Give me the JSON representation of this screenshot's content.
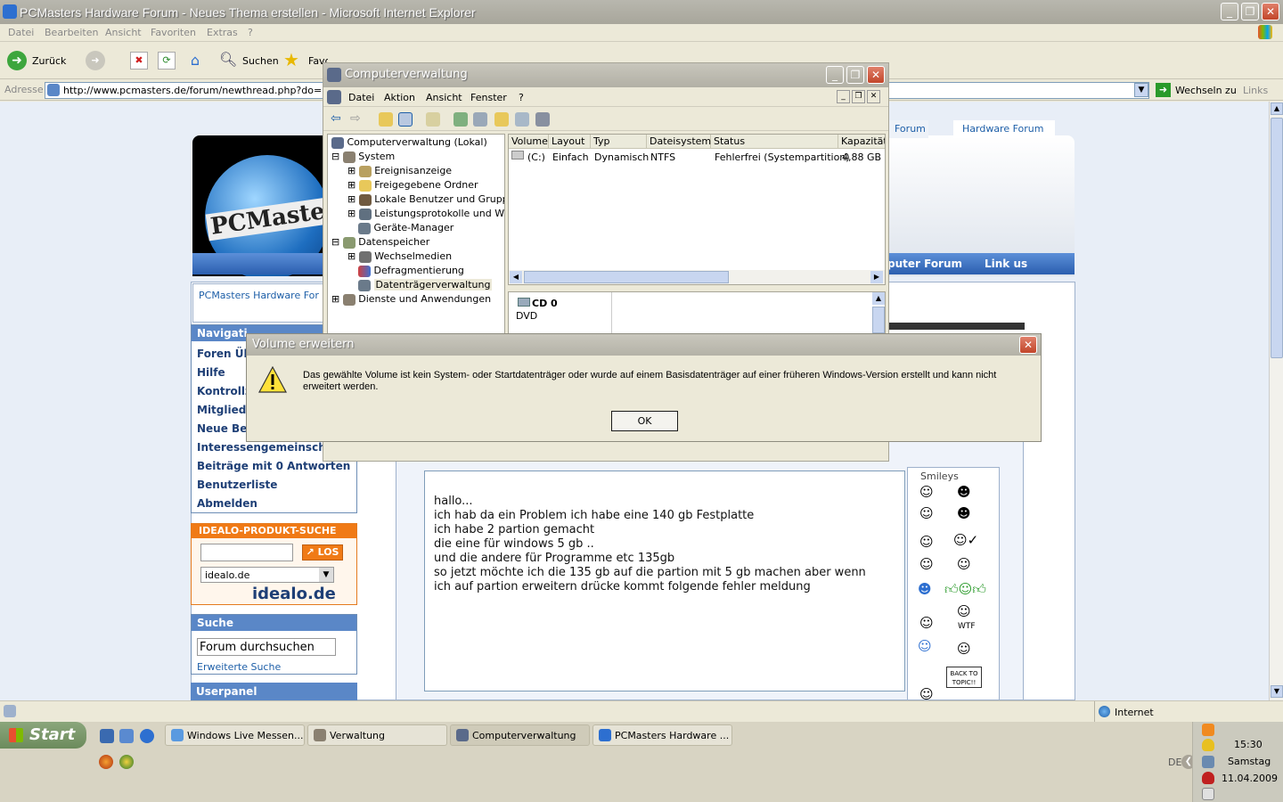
{
  "ie": {
    "title": "PCMasters Hardware Forum - Neues Thema erstellen - Microsoft Internet Explorer",
    "menu": [
      "Datei",
      "Bearbeiten",
      "Ansicht",
      "Favoriten",
      "Extras",
      "?"
    ],
    "back_label": "Zurück",
    "search_label": "Suchen",
    "favorites_label": "Favoriten",
    "address_label": "Adresse",
    "url": "http://www.pcmasters.de/forum/newthread.php?do=newthread&f=",
    "go_label": "Wechseln zu",
    "links_label": "Links",
    "status_zone": "Internet"
  },
  "forum": {
    "logo_text": "PCMaster",
    "tab_forum": "Forum",
    "tab_hw": "Hardware Forum",
    "nav_links": [
      "puter Forum",
      "Link us"
    ],
    "breadcrumb": "PCMasters Hardware For",
    "nav_title": "Navigati",
    "nav_items": [
      "Foren Üb",
      "Hilfe",
      "Kontrollz",
      "Mitgliede",
      "Neue Bei",
      "Interessengemeinsch",
      "Beiträge mit 0 Antworten",
      "Benutzerliste",
      "Abmelden"
    ],
    "idealo_title": "IDEALO-PRODUKT-SUCHE",
    "idealo_button": "LOS",
    "idealo_select": "idealo.de",
    "idealo_logo": "idealo.de",
    "search_title": "Suche",
    "search_placeholder": "Forum durchsuchen",
    "search_advanced": "Erweiterte Suche",
    "userpanel": "Userpanel",
    "smileys_label": "Smileys",
    "back_to_topic": "BACK TO TOPIC!!",
    "wtf": "WTF",
    "post_lines": [
      "hallo...",
      "ich hab da ein Problem ich habe eine 140 gb Festplatte",
      "ich habe 2 partion gemacht",
      "die eine für windows 5 gb ..",
      "und die andere für Programme etc 135gb",
      "so jetzt möchte ich die 135 gb auf die partion mit 5 gb machen aber wenn",
      "ich auf partion erweitern drücke kommt folgende fehler meldung"
    ]
  },
  "cv": {
    "title": "Computerverwaltung",
    "menu": [
      "Datei",
      "Aktion",
      "Ansicht",
      "Fenster",
      "?"
    ],
    "tree": [
      {
        "label": "Computerverwaltung (Lokal)",
        "indent": 0
      },
      {
        "label": "System",
        "indent": 1
      },
      {
        "label": "Ereignisanzeige",
        "indent": 2
      },
      {
        "label": "Freigegebene Ordner",
        "indent": 2
      },
      {
        "label": "Lokale Benutzer und Gruppen",
        "indent": 2
      },
      {
        "label": "Leistungsprotokolle und Warnungen",
        "indent": 2
      },
      {
        "label": "Geräte-Manager",
        "indent": 2
      },
      {
        "label": "Datenspeicher",
        "indent": 1
      },
      {
        "label": "Wechselmedien",
        "indent": 2
      },
      {
        "label": "Defragmentierung",
        "indent": 2
      },
      {
        "label": "Datenträgerverwaltung",
        "indent": 2
      },
      {
        "label": "Dienste und Anwendungen",
        "indent": 1
      }
    ],
    "columns": [
      "Volume",
      "Layout",
      "Typ",
      "Dateisystem",
      "Status",
      "Kapazität"
    ],
    "row": [
      "(C:)",
      "Einfach",
      "Dynamisch",
      "NTFS",
      "Fehlerfrei (Systempartition)",
      "4,88 GB"
    ],
    "disk_name": "CD 0",
    "disk_type": "DVD"
  },
  "dialog": {
    "title": "Volume erweitern",
    "message": "Das gewählte Volume ist kein System- oder Startdatenträger oder wurde auf einem Basisdatenträger auf einer früheren Windows-Version erstellt und kann nicht erweitert werden.",
    "ok": "OK"
  },
  "taskbar": {
    "start": "Start",
    "tasks": [
      "Windows Live Messen...",
      "Verwaltung",
      "Computerverwaltung",
      "PCMasters Hardware ..."
    ],
    "lang": "DE",
    "time": "15:30",
    "day": "Samstag",
    "date": "11.04.2009"
  }
}
